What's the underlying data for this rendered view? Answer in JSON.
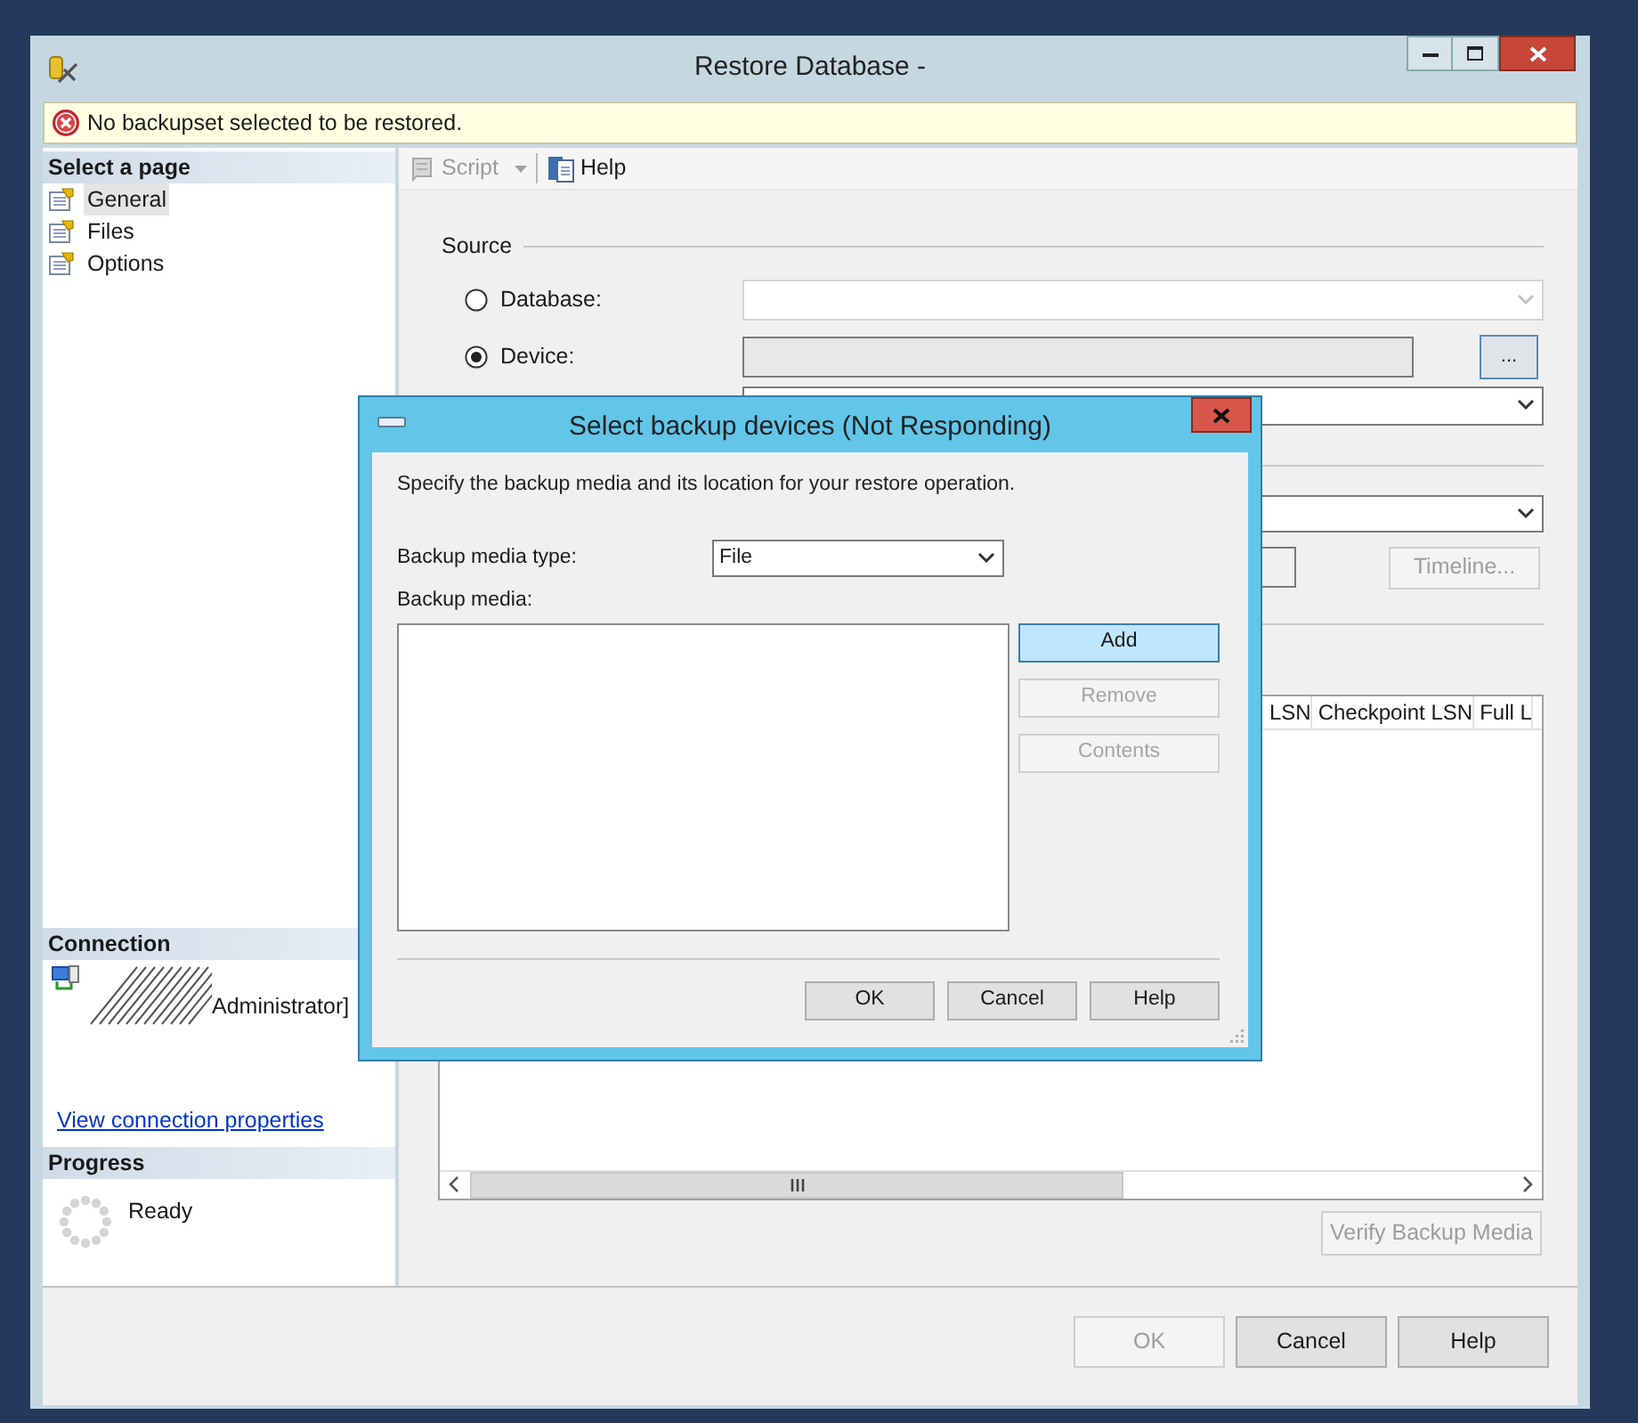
{
  "window": {
    "title": "Restore Database -"
  },
  "message": {
    "kind": "error",
    "text": "No backupset selected to be restored."
  },
  "sidebar": {
    "header": "Select a page",
    "items": [
      {
        "label": "General",
        "selected": true
      },
      {
        "label": "Files",
        "selected": false
      },
      {
        "label": "Options",
        "selected": false
      }
    ]
  },
  "connection": {
    "header": "Connection",
    "user": "Administrator]",
    "link": "View connection properties"
  },
  "progress": {
    "header": "Progress",
    "status": "Ready"
  },
  "toolbar": [
    {
      "kind": "script",
      "label": "Script",
      "disabled": true
    },
    {
      "kind": "help",
      "label": "Help",
      "disabled": false
    }
  ],
  "source": {
    "title": "Source",
    "options": [
      {
        "label": "Database:",
        "selected": false
      },
      {
        "label": "Device:",
        "selected": true
      }
    ],
    "browse_button": "..."
  },
  "timeline_button": {
    "label": "Timeline...",
    "disabled": true
  },
  "backup_sets_table": {
    "columns": [
      "LSN",
      "Checkpoint LSN",
      "Full L"
    ]
  },
  "verify_button": {
    "label": "Verify Backup Media",
    "disabled": true
  },
  "buttons": [
    {
      "label": "OK",
      "disabled": true
    },
    {
      "label": "Cancel",
      "disabled": false
    },
    {
      "label": "Help",
      "disabled": false
    }
  ],
  "dialog": {
    "title": "Select backup devices (Not Responding)",
    "description": "Specify the backup media and its location for your restore operation.",
    "media_type_label": "Backup media type:",
    "media_type": "File",
    "media_label": "Backup media:",
    "side_buttons": [
      {
        "label": "Add",
        "disabled": false,
        "focused": true
      },
      {
        "label": "Remove",
        "disabled": true,
        "focused": false
      },
      {
        "label": "Contents",
        "disabled": true,
        "focused": false
      }
    ],
    "buttons": [
      {
        "label": "OK",
        "disabled": false
      },
      {
        "label": "Cancel",
        "disabled": false
      },
      {
        "label": "Help",
        "disabled": false
      }
    ]
  }
}
